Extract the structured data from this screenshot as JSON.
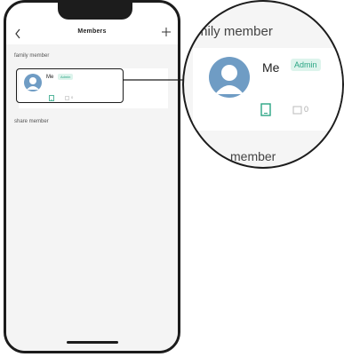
{
  "header": {
    "title": "Members",
    "back_icon": "chevron-left-icon",
    "add_icon": "plus-icon"
  },
  "sections": {
    "family": {
      "label": "family member",
      "members": [
        {
          "name": "Me",
          "badge": "Admin",
          "device_count": "0"
        }
      ]
    },
    "share": {
      "label": "share member"
    }
  },
  "zoom": {
    "section_label": "mily member",
    "member_name": "Me",
    "badge": "Admin",
    "device_count": "0",
    "section2_label": "member"
  },
  "colors": {
    "accent": "#2ba584",
    "badge_bg": "#ddf4ec",
    "avatar": "#6f9cc4",
    "frame": "#1c1c1c"
  }
}
